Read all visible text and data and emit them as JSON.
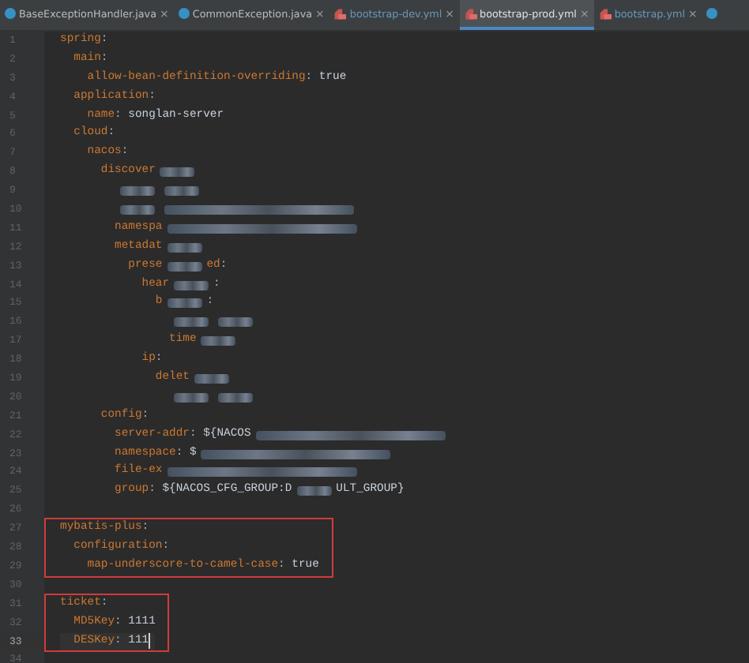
{
  "tabs": [
    {
      "kind": "java",
      "label": "BaseExceptionHandler.java",
      "close": "×",
      "selected": false
    },
    {
      "kind": "java",
      "label": "CommonException.java",
      "close": "×",
      "selected": false
    },
    {
      "kind": "yml",
      "label": "bootstrap-dev.yml",
      "close": "×",
      "selected": false
    },
    {
      "kind": "yml",
      "label": "bootstrap-prod.yml",
      "close": "×",
      "selected": true
    },
    {
      "kind": "yml",
      "label": "bootstrap.yml",
      "close": "×",
      "selected": false
    },
    {
      "kind": "java",
      "selected": false
    }
  ],
  "blocks": [
    {
      "boxed": false,
      "lines": [
        {
          "number": "1",
          "current": false,
          "segments": [
            {
              "kind": "key",
              "text": "spring"
            },
            {
              "kind": "punct",
              "text": ":"
            }
          ]
        },
        {
          "number": "2",
          "current": false,
          "segments": [
            {
              "kind": "key",
              "text": "  main"
            },
            {
              "kind": "punct",
              "text": ":"
            }
          ]
        },
        {
          "number": "3",
          "current": false,
          "segments": [
            {
              "kind": "key",
              "text": "    allow-bean-definition-overriding"
            },
            {
              "kind": "punct",
              "text": ": "
            },
            {
              "kind": "value",
              "text": "true"
            }
          ]
        },
        {
          "number": "4",
          "current": false,
          "segments": [
            {
              "kind": "key",
              "text": "  application"
            },
            {
              "kind": "punct",
              "text": ":"
            }
          ]
        },
        {
          "number": "5",
          "current": false,
          "segments": [
            {
              "kind": "key",
              "text": "    name"
            },
            {
              "kind": "punct",
              "text": ": "
            },
            {
              "kind": "value",
              "text": "songlan-server"
            }
          ]
        },
        {
          "number": "6",
          "current": false,
          "segments": [
            {
              "kind": "key",
              "text": "  cloud"
            },
            {
              "kind": "punct",
              "text": ":"
            }
          ]
        },
        {
          "number": "7",
          "current": false,
          "segments": [
            {
              "kind": "key",
              "text": "    nacos"
            },
            {
              "kind": "punct",
              "text": ":"
            }
          ]
        },
        {
          "number": "8",
          "current": false,
          "segments": [
            {
              "kind": "key",
              "text": "      discover"
            },
            {
              "kind": "blur_short"
            }
          ]
        },
        {
          "number": "9",
          "current": false,
          "segments": [
            {
              "kind": "indent_mid"
            },
            {
              "kind": "blur_short"
            },
            {
              "kind": "blur_short"
            }
          ]
        },
        {
          "number": "10",
          "current": false,
          "segments": [
            {
              "kind": "indent_mid"
            },
            {
              "kind": "blur_short"
            },
            {
              "kind": "blur_long"
            }
          ]
        },
        {
          "number": "11",
          "current": false,
          "segments": [
            {
              "kind": "key",
              "text": "        namespa"
            },
            {
              "kind": "blur_long"
            }
          ]
        },
        {
          "number": "12",
          "current": false,
          "segments": [
            {
              "kind": "key",
              "text": "        metadat"
            },
            {
              "kind": "blur_short"
            }
          ]
        },
        {
          "number": "13",
          "current": false,
          "segments": [
            {
              "kind": "key",
              "text": "          prese"
            },
            {
              "kind": "blur_short"
            },
            {
              "kind": "key",
              "text": "ed"
            },
            {
              "kind": "punct",
              "text": ":"
            }
          ]
        },
        {
          "number": "14",
          "current": false,
          "segments": [
            {
              "kind": "key",
              "text": "            hear"
            },
            {
              "kind": "blur_short"
            },
            {
              "kind": "punct",
              "text": ":"
            }
          ]
        },
        {
          "number": "15",
          "current": false,
          "segments": [
            {
              "kind": "key",
              "text": "              b"
            },
            {
              "kind": "blur_short"
            },
            {
              "kind": "punct",
              "text": ":"
            }
          ]
        },
        {
          "number": "16",
          "current": false,
          "segments": [
            {
              "kind": "indent_deep"
            },
            {
              "kind": "blur_short"
            },
            {
              "kind": "blur_short"
            }
          ]
        },
        {
          "number": "17",
          "current": false,
          "segments": [
            {
              "kind": "key",
              "text": "                time"
            },
            {
              "kind": "blur_short"
            }
          ]
        },
        {
          "number": "18",
          "current": false,
          "segments": [
            {
              "kind": "key",
              "text": "            ip"
            },
            {
              "kind": "punct",
              "text": ":"
            }
          ]
        },
        {
          "number": "19",
          "current": false,
          "segments": [
            {
              "kind": "key",
              "text": "              delet"
            },
            {
              "kind": "blur_short"
            }
          ]
        },
        {
          "number": "20",
          "current": false,
          "segments": [
            {
              "kind": "indent_deep"
            },
            {
              "kind": "blur_short"
            },
            {
              "kind": "blur_short"
            }
          ]
        },
        {
          "number": "21",
          "current": false,
          "segments": [
            {
              "kind": "key",
              "text": "      config"
            },
            {
              "kind": "punct",
              "text": ":"
            }
          ]
        },
        {
          "number": "22",
          "current": false,
          "segments": [
            {
              "kind": "key",
              "text": "        server-addr"
            },
            {
              "kind": "punct",
              "text": ": "
            },
            {
              "kind": "value",
              "text": "${NACOS"
            },
            {
              "kind": "blur_long"
            }
          ]
        },
        {
          "number": "23",
          "current": false,
          "segments": [
            {
              "kind": "key",
              "text": "        namespace"
            },
            {
              "kind": "punct",
              "text": ": "
            },
            {
              "kind": "value",
              "text": "$"
            },
            {
              "kind": "blur_long"
            }
          ]
        },
        {
          "number": "24",
          "current": false,
          "segments": [
            {
              "kind": "key",
              "text": "        file-ex"
            },
            {
              "kind": "blur_long"
            }
          ]
        },
        {
          "number": "25",
          "current": false,
          "segments": [
            {
              "kind": "key",
              "text": "        group"
            },
            {
              "kind": "punct",
              "text": ": "
            },
            {
              "kind": "value",
              "text": "${NACOS_CFG_GROUP:D"
            },
            {
              "kind": "blur_short"
            },
            {
              "kind": "value",
              "text": "ULT_GROUP}"
            }
          ]
        },
        {
          "number": "26",
          "current": false
        }
      ]
    },
    {
      "boxed": true,
      "lines": [
        {
          "number": "27",
          "current": false,
          "segments": [
            {
              "kind": "key",
              "text": "mybatis-plus"
            },
            {
              "kind": "punct",
              "text": ":"
            }
          ]
        },
        {
          "number": "28",
          "current": false,
          "segments": [
            {
              "kind": "key",
              "text": "  configuration"
            },
            {
              "kind": "punct",
              "text": ":"
            }
          ]
        },
        {
          "number": "29",
          "current": false,
          "segments": [
            {
              "kind": "key",
              "text": "    map-underscore-to-camel-case"
            },
            {
              "kind": "punct",
              "text": ": "
            },
            {
              "kind": "value",
              "text": "true"
            }
          ]
        }
      ]
    },
    {
      "boxed": false,
      "lines": [
        {
          "number": "30",
          "current": false
        }
      ]
    },
    {
      "boxed": true,
      "lines": [
        {
          "number": "31",
          "current": false,
          "segments": [
            {
              "kind": "key",
              "text": "ticket"
            },
            {
              "kind": "punct",
              "text": ":"
            }
          ]
        },
        {
          "number": "32",
          "current": false,
          "segments": [
            {
              "kind": "key",
              "text": "  MD5Key"
            },
            {
              "kind": "punct",
              "text": ": "
            },
            {
              "kind": "value",
              "text": "1111"
            }
          ]
        },
        {
          "number": "33",
          "current": true,
          "segments": [
            {
              "kind": "key",
              "text": "  DESKey"
            },
            {
              "kind": "punct",
              "text": ": "
            },
            {
              "kind": "value",
              "text": "111"
            }
          ]
        }
      ]
    },
    {
      "boxed": false,
      "lines": [
        {
          "number": "34",
          "current": false
        }
      ]
    }
  ]
}
